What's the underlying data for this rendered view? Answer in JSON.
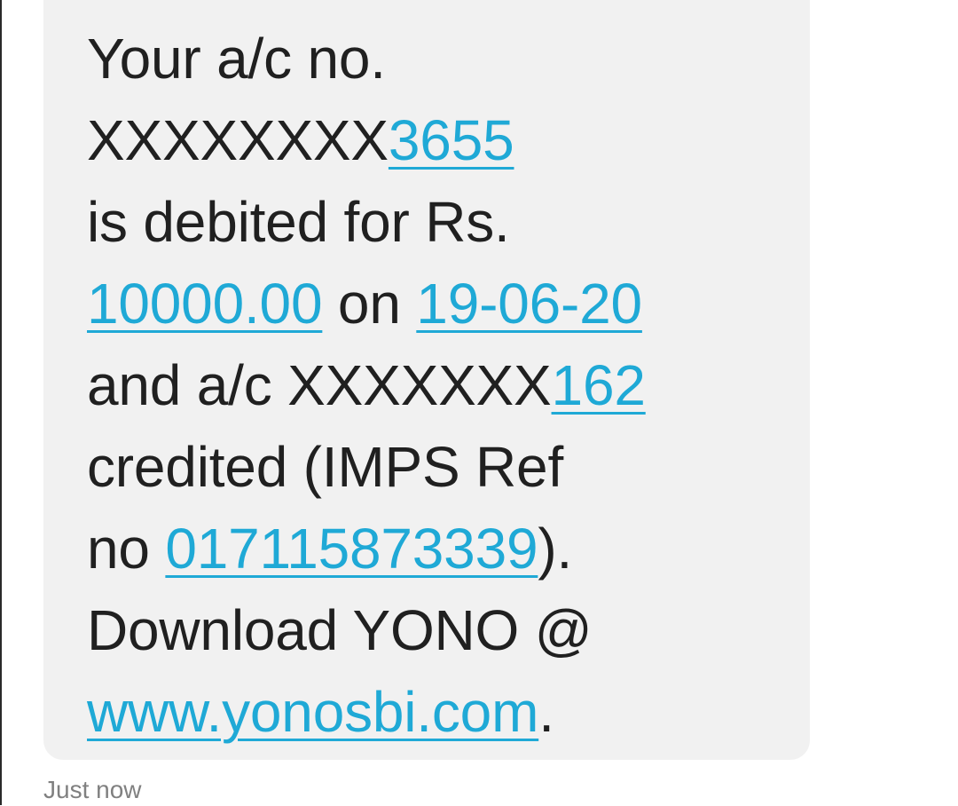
{
  "message": {
    "line1": "Your a/c no.",
    "line2_prefix": "XXXXXXXX",
    "line2_link": "3655",
    "line3": "is debited for Rs.",
    "line4_amount": "10000.00",
    "line4_mid": " on ",
    "line4_date": "19-06-20",
    "line5_prefix": "and a/c XXXXXXX",
    "line5_link": "162",
    "line6": "credited (IMPS Ref",
    "line7_prefix": "no ",
    "line7_ref": "017115873339",
    "line7_suffix": ").",
    "line8": "Download YONO @",
    "line9_url": "www.yonosbi.com",
    "line9_suffix": "."
  },
  "timestamp": "Just now",
  "colors": {
    "link": "#1fa9d6",
    "bubble": "#f1f1f1",
    "text": "#202020",
    "timestamp": "#808080"
  }
}
